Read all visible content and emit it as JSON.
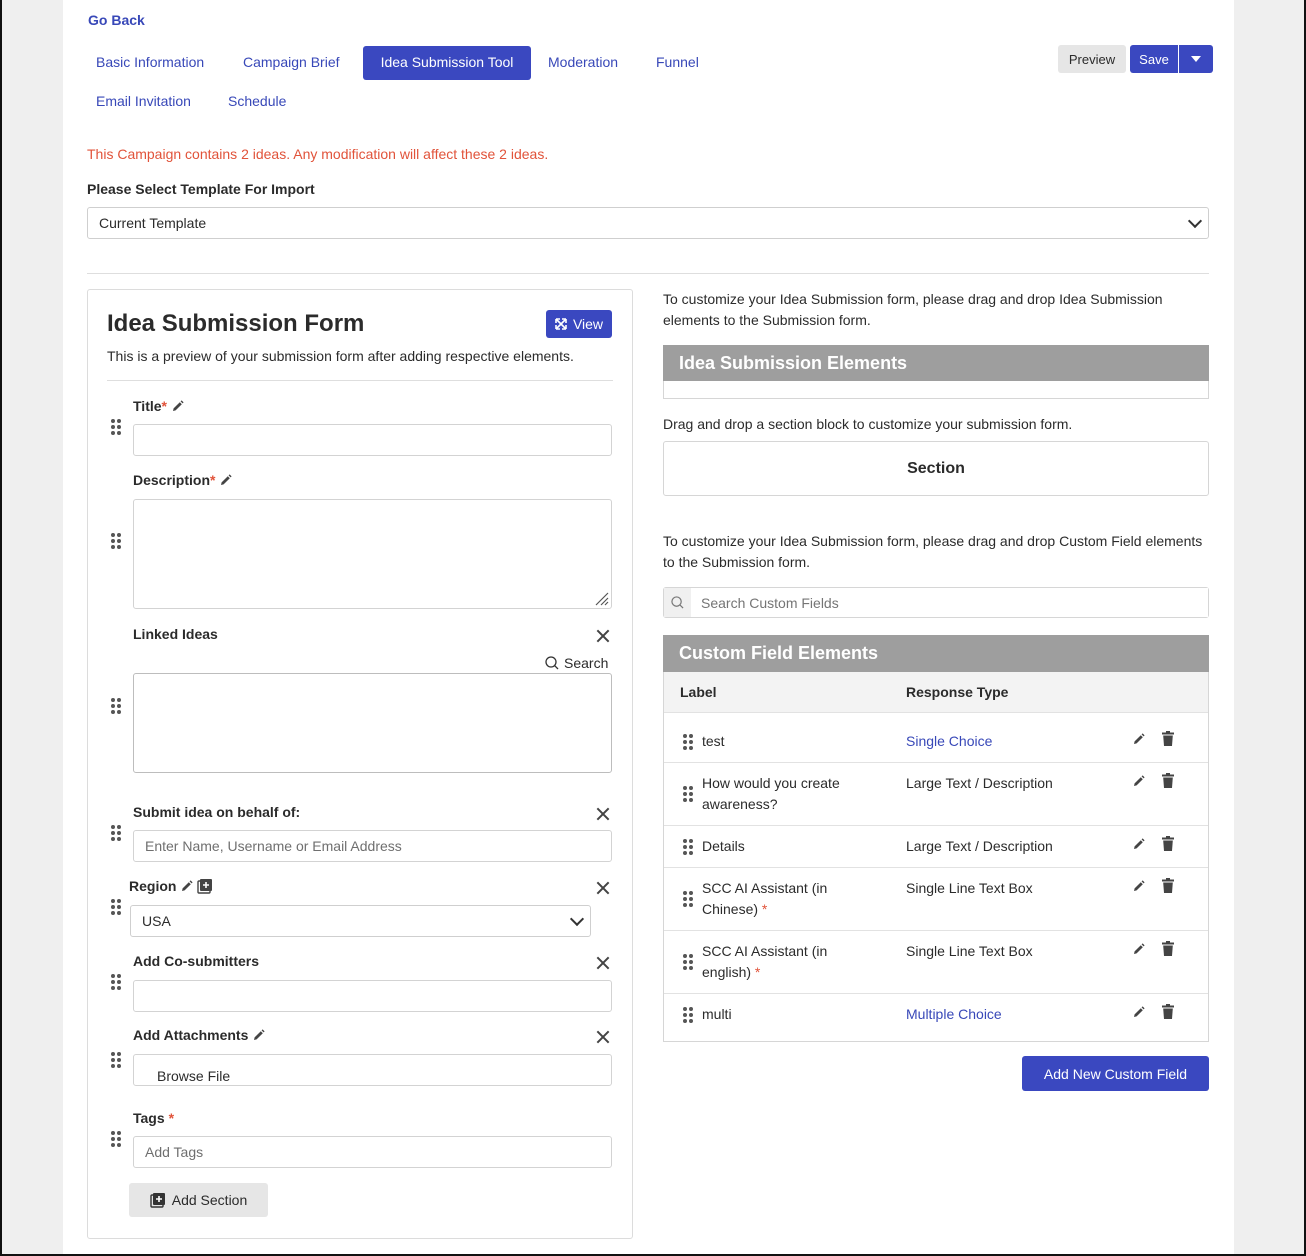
{
  "nav": {
    "go_back": "Go Back"
  },
  "tabs": [
    {
      "label": "Basic Information",
      "active": false
    },
    {
      "label": "Campaign Brief",
      "active": false
    },
    {
      "label": "Idea Submission Tool",
      "active": true
    },
    {
      "label": "Moderation",
      "active": false
    },
    {
      "label": "Funnel",
      "active": false
    },
    {
      "label": "Email Invitation",
      "active": false
    },
    {
      "label": "Schedule",
      "active": false
    }
  ],
  "toolbar": {
    "preview_label": "Preview",
    "save_label": "Save"
  },
  "warning": "This Campaign contains 2 ideas. Any modification will affect these 2 ideas.",
  "template_import": {
    "label": "Please Select Template For Import",
    "selected": "Current Template"
  },
  "form": {
    "title": "Idea Submission Form",
    "subtitle": "This is a preview of your submission form after adding respective elements.",
    "view_label": "View",
    "fields": {
      "title_label": "Title",
      "description_label": "Description",
      "linked_ideas_label": "Linked Ideas",
      "linked_search_label": "Search",
      "behalf_label": "Submit idea on behalf of:",
      "behalf_placeholder": "Enter Name, Username or Email Address",
      "region_label": "Region",
      "region_value": "USA",
      "cosubmitters_label": "Add Co-submitters",
      "attachments_label": "Add Attachments",
      "browse_label": "Browse File",
      "tags_label": "Tags",
      "tags_placeholder": "Add Tags",
      "required_mark": "*"
    },
    "add_section_label": "Add Section"
  },
  "right": {
    "intro_text": "To customize your Idea Submission form, please drag and drop Idea Submission elements to the Submission form.",
    "elements_header": "Idea Submission Elements",
    "section_hint": "Drag and drop a section block to customize your submission form.",
    "section_block": "Section",
    "custom_intro": "To customize your Idea Submission form, please drag and drop Custom Field elements to the Submission form.",
    "search_placeholder": "Search Custom Fields",
    "custom_header": "Custom Field Elements",
    "col_label": "Label",
    "col_response": "Response Type",
    "rows": [
      {
        "label": "test",
        "type": "Single Choice",
        "required": false
      },
      {
        "label": "How would you create awareness?",
        "type": "Large Text / Description",
        "required": false
      },
      {
        "label": "Details",
        "type": "Large Text / Description",
        "required": false
      },
      {
        "label": "SCC AI Assistant (in Chinese)",
        "type": "Single Line Text Box",
        "required": true
      },
      {
        "label": "SCC AI Assistant (in english)",
        "type": "Single Line Text Box",
        "required": true
      },
      {
        "label": "multi",
        "type": "Multiple Choice",
        "required": false
      }
    ],
    "add_custom_label": "Add New Custom Field"
  },
  "colors": {
    "accent": "#3a48c0",
    "link": "#3848b8",
    "warning": "#e1533a",
    "panel_header": "#9e9e9e"
  }
}
